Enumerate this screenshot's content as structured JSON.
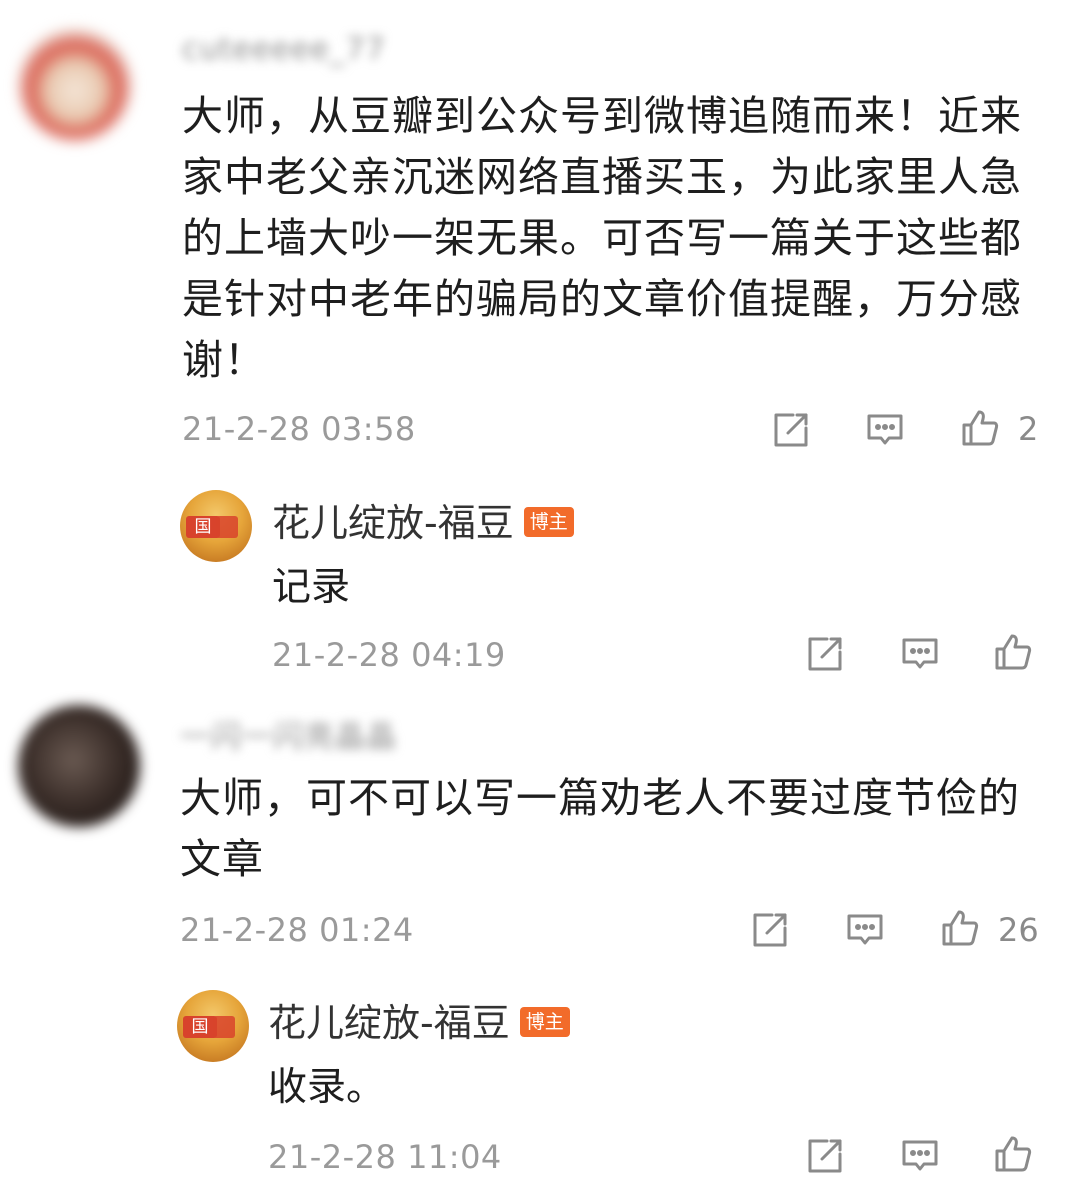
{
  "comments": [
    {
      "username": "cuteeeee_77",
      "text_lines": [
        "大师，从豆瓣到公众号到微博追随而来！近来",
        "家中老父亲沉迷网络直播买玉，为此家里人急",
        "的上墙大吵一架无果。可否写一篇关于这些都",
        "是针对中老年的骗局的文章价值提醒，万分感",
        "谢！"
      ],
      "timestamp": "21-2-28 03:58",
      "like_count": "2",
      "reply": {
        "name": "花儿绽放-福豆",
        "badge": "博主",
        "text": "记录",
        "timestamp": "21-2-28 04:19",
        "avatar_seal": "国"
      }
    },
    {
      "username": "一闪一闪亮晶晶",
      "text_lines": [
        "大师，可不可以写一篇劝老人不要过度节俭的",
        "文章"
      ],
      "timestamp": "21-2-28 01:24",
      "like_count": "26",
      "reply": {
        "name": "花儿绽放-福豆",
        "badge": "博主",
        "text": "收录。",
        "timestamp": "21-2-28 11:04",
        "avatar_seal": "国"
      }
    }
  ],
  "icons": {
    "share": "share-icon",
    "comment": "comment-icon",
    "like": "thumbs-up-icon"
  },
  "colors": {
    "badge": "#f26b2a",
    "timestamp": "#9a9a9a",
    "text": "#1e1e1e"
  }
}
